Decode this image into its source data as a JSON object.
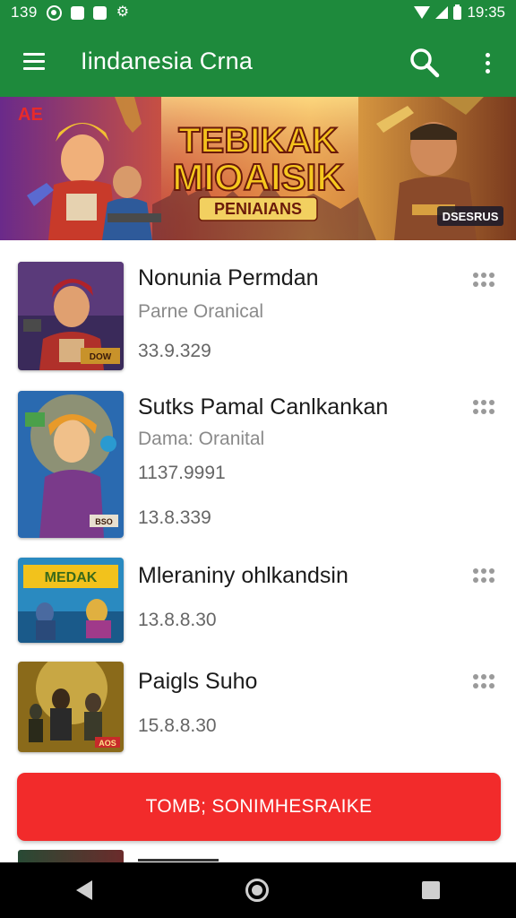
{
  "status_bar": {
    "left_time": "139",
    "right_time": "19:35",
    "icons": [
      "target-icon",
      "square-icon",
      "square-icon",
      "gear-icon",
      "wifi-icon",
      "signal-icon",
      "battery-icon"
    ]
  },
  "app_bar": {
    "title": "Iindanesia Crna",
    "background": "#1e8a3c"
  },
  "banner": {
    "title_line1": "TEBIKAK",
    "title_line2": "MIOAISIK",
    "subtitle": "PENIAIANS",
    "corner_top_left": "AE",
    "corner_bottom_right": "DSESRUS"
  },
  "games": [
    {
      "title": "Nonunia Permdan",
      "subtitle": "Parne Oranical",
      "numbers": [
        "33.9.329"
      ],
      "thumb_label": "DOW"
    },
    {
      "title": "Sutks Pamal Canlkankan",
      "subtitle": "Dama: Oranital",
      "numbers": [
        "1137.9991",
        "13.8.339"
      ],
      "thumb_label": "BSO"
    },
    {
      "title": "Mleraniny ohlkandsin",
      "subtitle": "",
      "numbers": [
        "13.8.8.30"
      ],
      "thumb_label": "MEDAK"
    },
    {
      "title": "Paigls Suho",
      "subtitle": "",
      "numbers": [
        "15.8.8.30"
      ],
      "thumb_label": "AOS"
    }
  ],
  "action_button": {
    "label": "TOMB; SONIMHESRAIKE",
    "color": "#f22b2b"
  }
}
